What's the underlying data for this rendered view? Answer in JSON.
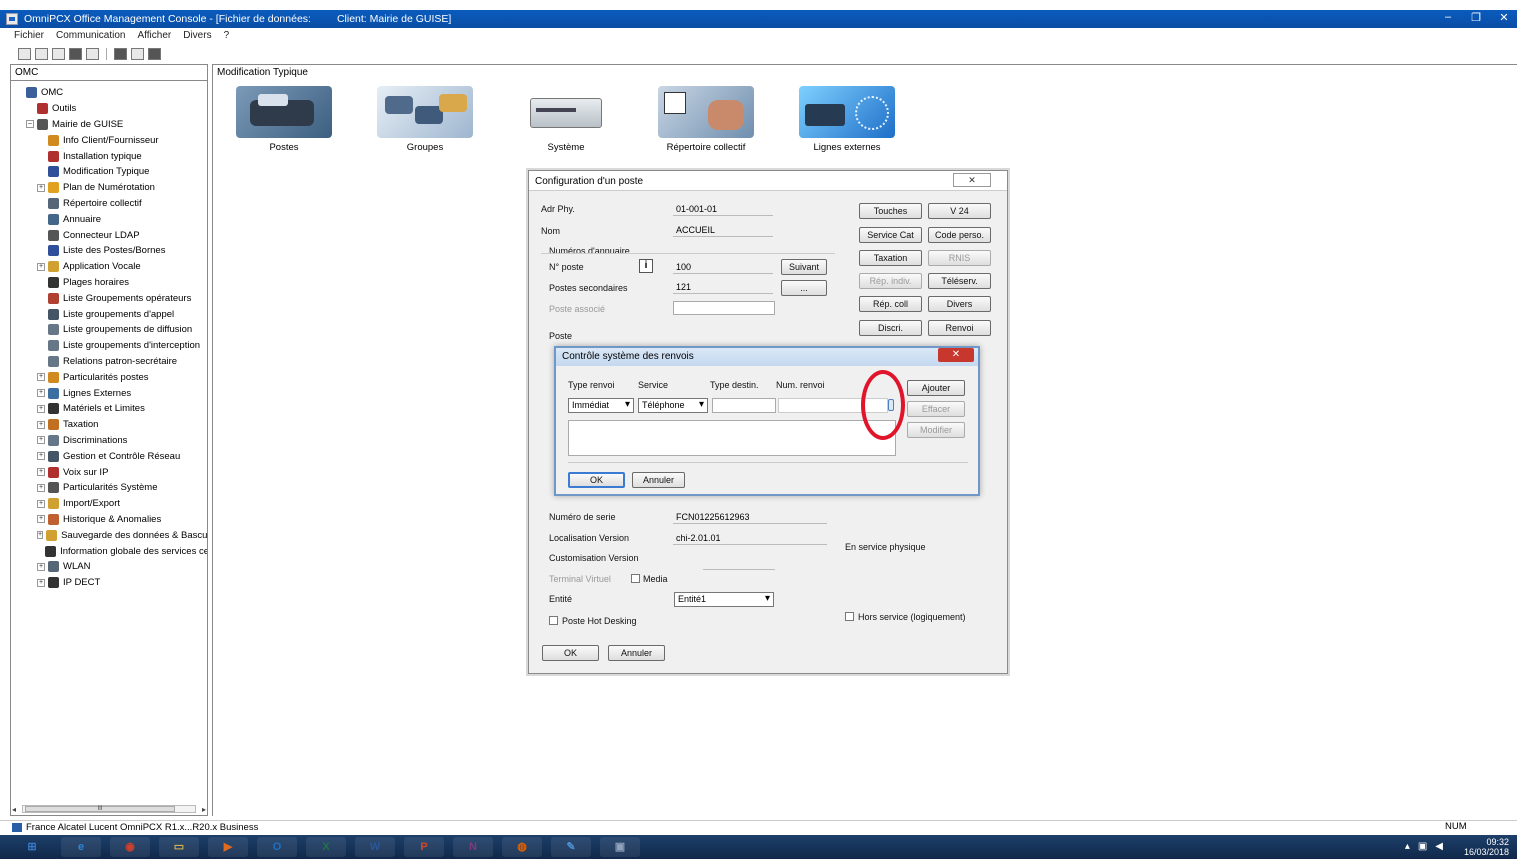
{
  "window": {
    "title": "OmniPCX Office Management Console - [Fichier de données:",
    "client": "Client: Mairie de GUISE]",
    "controls": [
      "–",
      "❐",
      "✕"
    ]
  },
  "menu": [
    "Fichier",
    "Communication",
    "Afficher",
    "Divers",
    "?"
  ],
  "left_pane": {
    "header": "OMC",
    "tree": [
      {
        "label": "OMC",
        "level": 0,
        "exp": "none",
        "color": "#3a5f9a"
      },
      {
        "label": "Outils",
        "level": 1,
        "exp": "none",
        "color": "#b03030"
      },
      {
        "label": "Mairie de GUISE",
        "level": 1,
        "exp": "minus",
        "color": "#555555"
      },
      {
        "label": "Info Client/Fournisseur",
        "level": 2,
        "exp": "none",
        "color": "#d08a20"
      },
      {
        "label": "Installation typique",
        "level": 2,
        "exp": "none",
        "color": "#b03030"
      },
      {
        "label": "Modification Typique",
        "level": 2,
        "exp": "none",
        "color": "#2f4f9a"
      },
      {
        "label": "Plan de Numérotation",
        "level": 2,
        "exp": "plus",
        "color": "#e0a020"
      },
      {
        "label": "Répertoire collectif",
        "level": 2,
        "exp": "none",
        "color": "#556677"
      },
      {
        "label": "Annuaire",
        "level": 2,
        "exp": "none",
        "color": "#446688"
      },
      {
        "label": "Connecteur LDAP",
        "level": 2,
        "exp": "none",
        "color": "#555555"
      },
      {
        "label": "Liste des Postes/Bornes",
        "level": 2,
        "exp": "none",
        "color": "#2f4f9a"
      },
      {
        "label": "Application Vocale",
        "level": 2,
        "exp": "plus",
        "color": "#d0a030"
      },
      {
        "label": "Plages horaires",
        "level": 2,
        "exp": "none",
        "color": "#333333"
      },
      {
        "label": "Liste Groupements opérateurs",
        "level": 2,
        "exp": "none",
        "color": "#b04030"
      },
      {
        "label": "Liste groupements d'appel",
        "level": 2,
        "exp": "none",
        "color": "#445566"
      },
      {
        "label": "Liste groupements de diffusion",
        "level": 2,
        "exp": "none",
        "color": "#667788"
      },
      {
        "label": "Liste groupements d'interception",
        "level": 2,
        "exp": "none",
        "color": "#667788"
      },
      {
        "label": "Relations patron-secrétaire",
        "level": 2,
        "exp": "none",
        "color": "#667788"
      },
      {
        "label": "Particularités postes",
        "level": 2,
        "exp": "plus",
        "color": "#d08a20"
      },
      {
        "label": "Lignes Externes",
        "level": 2,
        "exp": "plus",
        "color": "#3a6fa0"
      },
      {
        "label": "Matériels et Limites",
        "level": 2,
        "exp": "plus",
        "color": "#333333"
      },
      {
        "label": "Taxation",
        "level": 2,
        "exp": "plus",
        "color": "#c07020"
      },
      {
        "label": "Discriminations",
        "level": 2,
        "exp": "plus",
        "color": "#667788"
      },
      {
        "label": "Gestion et Contrôle Réseau",
        "level": 2,
        "exp": "plus",
        "color": "#445566"
      },
      {
        "label": "Voix sur IP",
        "level": 2,
        "exp": "plus",
        "color": "#b03030"
      },
      {
        "label": "Particularités Système",
        "level": 2,
        "exp": "plus",
        "color": "#555555"
      },
      {
        "label": "Import/Export",
        "level": 2,
        "exp": "plus",
        "color": "#d0a030"
      },
      {
        "label": "Historique & Anomalies",
        "level": 2,
        "exp": "plus",
        "color": "#c06030"
      },
      {
        "label": "Sauvegarde des données & Bascule",
        "level": 2,
        "exp": "plus",
        "color": "#d0a030"
      },
      {
        "label": "Information globale des services ce",
        "level": 2,
        "exp": "none",
        "color": "#333333"
      },
      {
        "label": "WLAN",
        "level": 2,
        "exp": "plus",
        "color": "#556677"
      },
      {
        "label": "IP DECT",
        "level": 2,
        "exp": "plus",
        "color": "#333333"
      }
    ],
    "scroll_glyph": "III"
  },
  "right_pane": {
    "header": "Modification Typique",
    "icons": [
      "Postes",
      "Groupes",
      "Système",
      "Répertoire collectif",
      "Lignes externes"
    ]
  },
  "poste_dialog": {
    "title": "Configuration d'un poste",
    "close": "✕",
    "adr_phy_label": "Adr Phy.",
    "adr_phy_value": "01-001-01",
    "nom_label": "Nom",
    "nom_value": "ACCUEIL",
    "numeros_label": "Numéros d'annuaire",
    "n_poste_label": "N° poste",
    "n_poste_value": "100",
    "suivant": "Suivant",
    "postes_sec_label": "Postes secondaires",
    "postes_sec_value": "121",
    "more": "...",
    "poste_associe_label": "Poste associé",
    "poste_label": "Poste",
    "numero_serie_label": "Numéro de serie",
    "numero_serie_value": "FCN01225612963",
    "localisation_label": "Localisation Version",
    "localisation_value": "chi-2.01.01",
    "customisation_label": "Customisation Version",
    "terminal_virtuel_label": "Terminal Virtuel",
    "media_label": "Media",
    "entite_label": "Entité",
    "entite_value": "Entité1",
    "hot_desking_label": "Poste Hot Desking",
    "en_service": "En service physique",
    "hors_service": "Hors service (logiquement)",
    "ok": "OK",
    "annuler": "Annuler",
    "info": "i",
    "side_buttons": [
      "Touches",
      "V 24",
      "Service Cat",
      "Code perso.",
      "Taxation",
      "RNIS",
      "Rép. indiv.",
      "Téléserv.",
      "Rép. coll",
      "Divers",
      "Discri.",
      "Renvoi"
    ]
  },
  "renvoi_dialog": {
    "title": "Contrôle système des renvois",
    "close": "✕",
    "col_type_renvoi": "Type renvoi",
    "col_service": "Service",
    "col_type_destin": "Type destin.",
    "col_num_renvoi": "Num. renvoi",
    "type_renvoi_value": "Immédiat",
    "service_value": "Téléphone",
    "ajouter": "Ajouter",
    "effacer": "Effacer",
    "modifier": "Modifier",
    "ok": "OK",
    "annuler": "Annuler"
  },
  "statusbar": {
    "left": "France Alcatel Lucent OmniPCX R1.x...R20.x Business",
    "num": "NUM"
  },
  "taskbar": {
    "apps": [
      {
        "name": "start-button",
        "glyph": "⊞",
        "color": "#3a78c8"
      },
      {
        "name": "ie-app",
        "glyph": "e",
        "color": "#2b86d6"
      },
      {
        "name": "chrome-app",
        "glyph": "◉",
        "color": "#d0402f"
      },
      {
        "name": "explorer-app",
        "glyph": "▭",
        "color": "#d8b04a"
      },
      {
        "name": "media-app",
        "glyph": "▶",
        "color": "#e06a20"
      },
      {
        "name": "outlook-app",
        "glyph": "O",
        "color": "#1f6fc2"
      },
      {
        "name": "excel-app",
        "glyph": "X",
        "color": "#207245"
      },
      {
        "name": "word-app",
        "glyph": "W",
        "color": "#2b579a"
      },
      {
        "name": "powerpoint-app",
        "glyph": "P",
        "color": "#d24726"
      },
      {
        "name": "onenote-app",
        "glyph": "N",
        "color": "#80397b"
      },
      {
        "name": "firefox-app",
        "glyph": "◍",
        "color": "#e66000"
      },
      {
        "name": "paint-app",
        "glyph": "✎",
        "color": "#4a90d0"
      },
      {
        "name": "omc-app",
        "glyph": "▣",
        "color": "#8fa3bb"
      }
    ],
    "time": "09:32",
    "date": "16/03/2018"
  }
}
